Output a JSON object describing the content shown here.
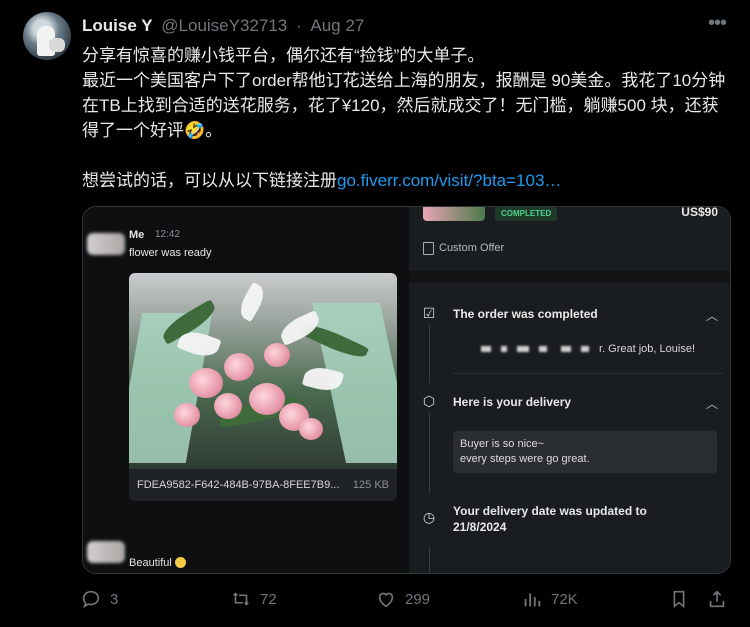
{
  "tweet": {
    "name": "Louise Y",
    "handle": "@LouiseY32713",
    "separator": "·",
    "date": "Aug 27",
    "line1": "分享有惊喜的赚小钱平台，偶尔还有“捡钱”的大单子。",
    "line2": "最近一个美国客户下了order帮他订花送给上海的朋友，报酬是 90美金。我花了10分钟在TB上找到合适的送花服务，花了¥120，然后就成交了！无门槛，躺赚500 块，还获得了一个好评🤣。",
    "line3_prefix": "想尝试的话，可以从以下链接注册",
    "link": "go.fiverr.com/visit/?bta=103…"
  },
  "chat": {
    "sender": "Me",
    "time": "12:42",
    "message1": "flower was ready",
    "file_name": "FDEA9582-F642-484B-97BA-8FEE7B9...",
    "file_size": "125 KB",
    "message2": "Beautiful"
  },
  "order_panel": {
    "status_badge": "COMPLETED",
    "price": "US$90",
    "offer_label": "Custom Offer",
    "completed_title": "The order was completed",
    "completed_text": "r. Great job, Louise!",
    "delivery_title": "Here is your delivery",
    "delivery_line1": "Buyer is so nice~",
    "delivery_line2": "every steps were go great.",
    "date_title_1": "Your delivery date was updated to",
    "date_title_2": "21/8/2024"
  },
  "actions": {
    "replies": "3",
    "reposts": "72",
    "likes": "299",
    "views": "72K"
  },
  "colors": {
    "link": "#1d9bf0",
    "muted": "#71767b",
    "badge_text": "#4fd18b"
  },
  "icons": [
    "more-icon",
    "reply-icon",
    "repost-icon",
    "like-icon",
    "views-icon",
    "bookmark-icon",
    "share-icon",
    "offer-icon",
    "order-completed-icon",
    "delivery-box-icon",
    "calendar-clock-icon",
    "chevron-up-icon"
  ]
}
